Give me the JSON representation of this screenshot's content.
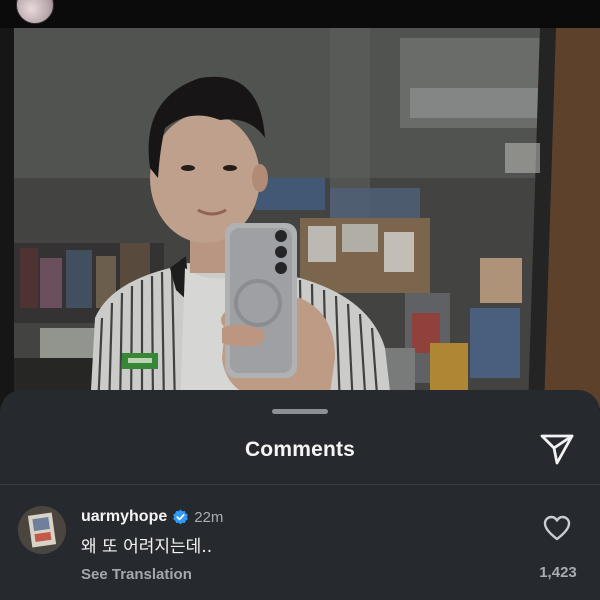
{
  "post": {
    "image_alt": "mirror selfie photo"
  },
  "comments_sheet": {
    "title": "Comments",
    "share_icon": "send-icon"
  },
  "comments": [
    {
      "username": "uarmyhope",
      "verified": true,
      "time": "22m",
      "text": "왜 또 어려지는데..",
      "translation_label": "See Translation",
      "like_icon": "heart-outline-icon",
      "likes": "1,423"
    }
  ],
  "colors": {
    "sheet_background": "#262a2f",
    "verified_blue": "#2f9bf7",
    "primary_text": "#f3f3f3",
    "secondary_text": "#a9adb2"
  }
}
